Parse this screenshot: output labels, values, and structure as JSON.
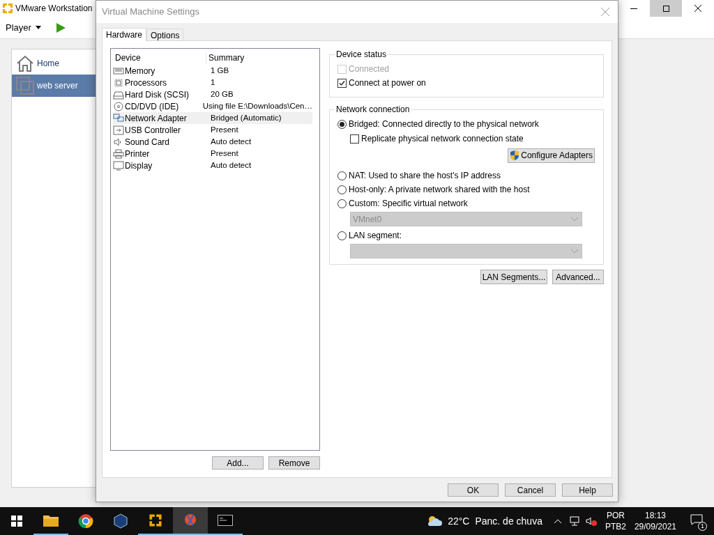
{
  "main_window": {
    "title": "VMware Workstation",
    "toolbar": {
      "menu": "Player"
    },
    "library": [
      {
        "label": "Home",
        "kind": "home",
        "selected": false
      },
      {
        "label": "web server",
        "kind": "vm",
        "selected": true
      }
    ]
  },
  "dialog": {
    "title": "Virtual Machine Settings",
    "tabs": [
      {
        "label": "Hardware",
        "selected": true
      },
      {
        "label": "Options",
        "selected": false
      }
    ],
    "devices": {
      "columns": [
        "Device",
        "Summary"
      ],
      "rows": [
        {
          "kind": "memory",
          "device": "Memory",
          "summary": "1 GB",
          "selected": false
        },
        {
          "kind": "cpu",
          "device": "Processors",
          "summary": "1",
          "selected": false
        },
        {
          "kind": "disk",
          "device": "Hard Disk (SCSI)",
          "summary": "20 GB",
          "selected": false
        },
        {
          "kind": "cd",
          "device": "CD/DVD (IDE)",
          "summary": "Using file E:\\Downloads\\Cen…",
          "selected": false
        },
        {
          "kind": "network",
          "device": "Network Adapter",
          "summary": "Bridged (Automatic)",
          "selected": true
        },
        {
          "kind": "usb",
          "device": "USB Controller",
          "summary": "Present",
          "selected": false
        },
        {
          "kind": "sound",
          "device": "Sound Card",
          "summary": "Auto detect",
          "selected": false
        },
        {
          "kind": "printer",
          "device": "Printer",
          "summary": "Present",
          "selected": false
        },
        {
          "kind": "display",
          "device": "Display",
          "summary": "Auto detect",
          "selected": false
        }
      ],
      "buttons": [
        "Add...",
        "Remove"
      ]
    },
    "device_status": {
      "title": "Device status",
      "options": [
        {
          "label": "Connected",
          "checked": false,
          "disabled": true
        },
        {
          "label": "Connect at power on",
          "checked": true,
          "disabled": false
        }
      ]
    },
    "network_connection": {
      "title": "Network connection",
      "bridged": {
        "label": "Bridged: Connected directly to the physical network",
        "selected": true
      },
      "replicate": {
        "label": "Replicate physical network connection state",
        "checked": false
      },
      "configure_button": "Configure Adapters",
      "nat": {
        "label": "NAT: Used to share the host's IP address",
        "selected": false
      },
      "host_only": {
        "label": "Host-only: A private network shared with the host",
        "selected": false
      },
      "custom": {
        "label": "Custom: Specific virtual network",
        "selected": false,
        "value": "VMnet0"
      },
      "lan_segment": {
        "label": "LAN segment:",
        "selected": false
      }
    },
    "section_buttons": [
      "LAN Segments...",
      "Advanced..."
    ],
    "footer_buttons": [
      "OK",
      "Cancel",
      "Help"
    ]
  },
  "taskbar": {
    "weather": "22°C",
    "weather_text": "Panc. de chuva",
    "language": "POR",
    "layout": "PTB2",
    "time": "18:13",
    "date": "29/09/2021",
    "notifications": "1"
  }
}
